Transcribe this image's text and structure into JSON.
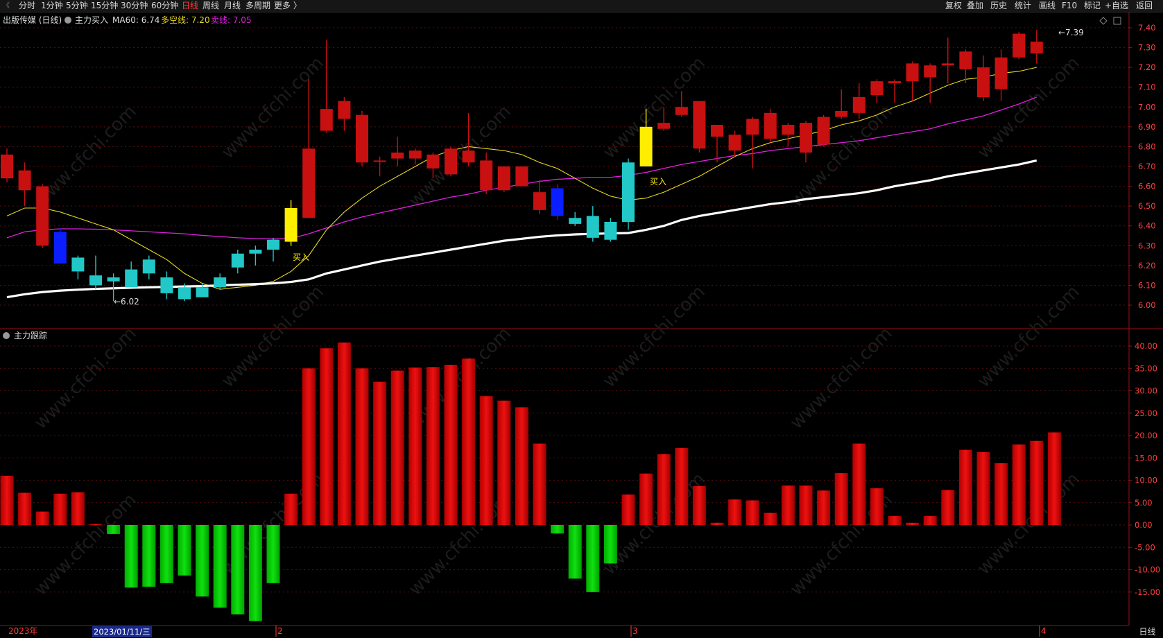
{
  "toolbar": {
    "left_items": [
      "分时",
      "1分钟",
      "5分钟",
      "15分钟",
      "30分钟",
      "60分钟",
      "日线",
      "周线",
      "月线",
      "多周期",
      "更多 〉"
    ],
    "active": "日线",
    "right_items": [
      "复权",
      "叠加",
      "历史",
      "统计",
      "画线",
      "F10",
      "标记",
      "+自选",
      "返回"
    ]
  },
  "main_panel": {
    "title": "出版传媒 (日线)",
    "indicator": "主力买入",
    "ma60_label": "MA60: 6.74",
    "duokong_label": "多空线: 7.20",
    "maixian_label": "卖线: 7.05",
    "buy_marker": "买入",
    "low_marker": "←6.02",
    "high_marker": "←7.39",
    "price_ticks": [
      "7.40",
      "7.30",
      "7.20",
      "7.10",
      "7.00",
      "6.90",
      "6.80",
      "6.70",
      "6.60",
      "6.50",
      "6.40",
      "6.30",
      "6.20",
      "6.10",
      "6.00"
    ]
  },
  "sub_panel": {
    "title": "主力跟踪",
    "ticks": [
      "40.00",
      "35.00",
      "30.00",
      "25.00",
      "20.00",
      "15.00",
      "10.00",
      "5.00",
      "0.00",
      "-5.00",
      "-10.00",
      "-15.00"
    ]
  },
  "date_axis": {
    "labels": [
      "2023年",
      "2",
      "3",
      "4"
    ],
    "cursor_date": "2023/01/11/三"
  },
  "bottom_tab": "日线",
  "watermark": "www.cfchi.com",
  "colors": {
    "up": "#c81010",
    "down": "#22c8c8",
    "yellow": "#ffee00",
    "blue": "#0a1eff",
    "ma60": "#ffffff",
    "duokong": "#e8d820",
    "maixian": "#e020e0",
    "bar_pos": "#ee1111",
    "bar_neg": "#10e010",
    "axis": "#9a1010"
  },
  "chart_data": {
    "type": "candlestick",
    "ylim": [
      5.95,
      7.45
    ],
    "sub_ylim": [
      -21,
      43
    ],
    "candles": [
      {
        "o": 6.64,
        "h": 6.79,
        "l": 6.62,
        "c": 6.76,
        "k": "up"
      },
      {
        "o": 6.58,
        "h": 6.72,
        "l": 6.5,
        "c": 6.68,
        "k": "up"
      },
      {
        "o": 6.3,
        "h": 6.61,
        "l": 6.29,
        "c": 6.6,
        "k": "up"
      },
      {
        "o": 6.37,
        "h": 6.39,
        "l": 6.21,
        "c": 6.21,
        "k": "blue"
      },
      {
        "o": 6.24,
        "h": 6.25,
        "l": 6.13,
        "c": 6.17,
        "k": "down"
      },
      {
        "o": 6.15,
        "h": 6.25,
        "l": 6.08,
        "c": 6.1,
        "k": "down"
      },
      {
        "o": 6.14,
        "h": 6.16,
        "l": 6.02,
        "c": 6.12,
        "k": "down"
      },
      {
        "o": 6.18,
        "h": 6.22,
        "l": 6.09,
        "c": 6.09,
        "k": "down"
      },
      {
        "o": 6.23,
        "h": 6.25,
        "l": 6.13,
        "c": 6.16,
        "k": "down"
      },
      {
        "o": 6.14,
        "h": 6.17,
        "l": 6.03,
        "c": 6.06,
        "k": "down"
      },
      {
        "o": 6.09,
        "h": 6.11,
        "l": 6.02,
        "c": 6.03,
        "k": "down"
      },
      {
        "o": 6.09,
        "h": 6.11,
        "l": 6.04,
        "c": 6.04,
        "k": "down"
      },
      {
        "o": 6.14,
        "h": 6.16,
        "l": 6.08,
        "c": 6.09,
        "k": "down"
      },
      {
        "o": 6.26,
        "h": 6.28,
        "l": 6.16,
        "c": 6.19,
        "k": "down"
      },
      {
        "o": 6.28,
        "h": 6.3,
        "l": 6.2,
        "c": 6.26,
        "k": "down"
      },
      {
        "o": 6.33,
        "h": 6.34,
        "l": 6.22,
        "c": 6.28,
        "k": "down"
      },
      {
        "o": 6.32,
        "h": 6.53,
        "l": 6.3,
        "c": 6.49,
        "k": "yellow"
      },
      {
        "o": 6.44,
        "h": 7.14,
        "l": 6.44,
        "c": 6.79,
        "k": "up"
      },
      {
        "o": 6.88,
        "h": 7.34,
        "l": 6.87,
        "c": 6.99,
        "k": "up"
      },
      {
        "o": 6.94,
        "h": 7.05,
        "l": 6.88,
        "c": 7.03,
        "k": "up"
      },
      {
        "o": 6.72,
        "h": 6.98,
        "l": 6.7,
        "c": 6.96,
        "k": "up"
      },
      {
        "o": 6.73,
        "h": 6.75,
        "l": 6.65,
        "c": 6.73,
        "k": "up"
      },
      {
        "o": 6.74,
        "h": 6.85,
        "l": 6.7,
        "c": 6.77,
        "k": "up"
      },
      {
        "o": 6.74,
        "h": 6.79,
        "l": 6.71,
        "c": 6.78,
        "k": "up"
      },
      {
        "o": 6.69,
        "h": 6.77,
        "l": 6.64,
        "c": 6.76,
        "k": "up"
      },
      {
        "o": 6.66,
        "h": 6.8,
        "l": 6.65,
        "c": 6.79,
        "k": "up"
      },
      {
        "o": 6.72,
        "h": 6.97,
        "l": 6.7,
        "c": 6.78,
        "k": "up"
      },
      {
        "o": 6.58,
        "h": 6.77,
        "l": 6.56,
        "c": 6.73,
        "k": "up"
      },
      {
        "o": 6.58,
        "h": 6.7,
        "l": 6.57,
        "c": 6.7,
        "k": "up"
      },
      {
        "o": 6.6,
        "h": 6.7,
        "l": 6.6,
        "c": 6.7,
        "k": "up"
      },
      {
        "o": 6.48,
        "h": 6.63,
        "l": 6.46,
        "c": 6.57,
        "k": "up"
      },
      {
        "o": 6.59,
        "h": 6.61,
        "l": 6.43,
        "c": 6.45,
        "k": "blue"
      },
      {
        "o": 6.44,
        "h": 6.47,
        "l": 6.4,
        "c": 6.41,
        "k": "down"
      },
      {
        "o": 6.45,
        "h": 6.5,
        "l": 6.32,
        "c": 6.34,
        "k": "down"
      },
      {
        "o": 6.42,
        "h": 6.44,
        "l": 6.32,
        "c": 6.33,
        "k": "down"
      },
      {
        "o": 6.72,
        "h": 6.74,
        "l": 6.38,
        "c": 6.42,
        "k": "down"
      },
      {
        "o": 6.7,
        "h": 6.99,
        "l": 6.7,
        "c": 6.9,
        "k": "yellow"
      },
      {
        "o": 6.89,
        "h": 7.0,
        "l": 6.88,
        "c": 6.92,
        "k": "up"
      },
      {
        "o": 6.96,
        "h": 7.08,
        "l": 6.95,
        "c": 7.0,
        "k": "up"
      },
      {
        "o": 6.79,
        "h": 7.03,
        "l": 6.77,
        "c": 7.03,
        "k": "up"
      },
      {
        "o": 6.85,
        "h": 6.91,
        "l": 6.72,
        "c": 6.91,
        "k": "up"
      },
      {
        "o": 6.78,
        "h": 6.88,
        "l": 6.75,
        "c": 6.86,
        "k": "up"
      },
      {
        "o": 6.86,
        "h": 6.95,
        "l": 6.69,
        "c": 6.94,
        "k": "up"
      },
      {
        "o": 6.84,
        "h": 6.99,
        "l": 6.82,
        "c": 6.97,
        "k": "up"
      },
      {
        "o": 6.86,
        "h": 6.92,
        "l": 6.8,
        "c": 6.91,
        "k": "up"
      },
      {
        "o": 6.77,
        "h": 6.93,
        "l": 6.72,
        "c": 6.92,
        "k": "up"
      },
      {
        "o": 6.81,
        "h": 6.96,
        "l": 6.8,
        "c": 6.95,
        "k": "up"
      },
      {
        "o": 6.95,
        "h": 7.09,
        "l": 6.94,
        "c": 6.98,
        "k": "up"
      },
      {
        "o": 6.97,
        "h": 7.12,
        "l": 6.94,
        "c": 7.05,
        "k": "up"
      },
      {
        "o": 7.06,
        "h": 7.14,
        "l": 7.02,
        "c": 7.13,
        "k": "up"
      },
      {
        "o": 7.12,
        "h": 7.14,
        "l": 7.02,
        "c": 7.13,
        "k": "up"
      },
      {
        "o": 7.13,
        "h": 7.23,
        "l": 7.03,
        "c": 7.22,
        "k": "up"
      },
      {
        "o": 7.15,
        "h": 7.22,
        "l": 7.02,
        "c": 7.21,
        "k": "up"
      },
      {
        "o": 7.21,
        "h": 7.35,
        "l": 7.12,
        "c": 7.22,
        "k": "up"
      },
      {
        "o": 7.19,
        "h": 7.29,
        "l": 7.12,
        "c": 7.28,
        "k": "up"
      },
      {
        "o": 7.05,
        "h": 7.26,
        "l": 7.03,
        "c": 7.2,
        "k": "up"
      },
      {
        "o": 7.09,
        "h": 7.29,
        "l": 7.03,
        "c": 7.25,
        "k": "up"
      },
      {
        "o": 7.25,
        "h": 7.38,
        "l": 7.24,
        "c": 7.37,
        "k": "up"
      },
      {
        "o": 7.27,
        "h": 7.39,
        "l": 7.22,
        "c": 7.33,
        "k": "up"
      }
    ],
    "ma60": [
      6.04,
      6.055,
      6.066,
      6.073,
      6.078,
      6.082,
      6.085,
      6.088,
      6.09,
      6.092,
      6.094,
      6.096,
      6.1,
      6.103,
      6.106,
      6.11,
      6.117,
      6.13,
      6.16,
      6.18,
      6.2,
      6.22,
      6.235,
      6.25,
      6.265,
      6.28,
      6.295,
      6.31,
      6.325,
      6.335,
      6.345,
      6.352,
      6.357,
      6.36,
      6.362,
      6.364,
      6.38,
      6.4,
      6.43,
      6.45,
      6.465,
      6.48,
      6.495,
      6.51,
      6.52,
      6.535,
      6.545,
      6.555,
      6.565,
      6.58,
      6.6,
      6.615,
      6.63,
      6.65,
      6.665,
      6.68,
      6.695,
      6.71,
      6.73
    ],
    "duokong": [
      6.45,
      6.49,
      6.49,
      6.47,
      6.44,
      6.41,
      6.38,
      6.33,
      6.28,
      6.23,
      6.16,
      6.11,
      6.08,
      6.09,
      6.1,
      6.12,
      6.17,
      6.25,
      6.38,
      6.47,
      6.54,
      6.6,
      6.65,
      6.7,
      6.75,
      6.78,
      6.8,
      6.79,
      6.78,
      6.76,
      6.72,
      6.69,
      6.64,
      6.59,
      6.55,
      6.53,
      6.54,
      6.57,
      6.61,
      6.65,
      6.7,
      6.75,
      6.79,
      6.82,
      6.84,
      6.86,
      6.88,
      6.91,
      6.93,
      6.96,
      7.0,
      7.03,
      7.07,
      7.11,
      7.14,
      7.15,
      7.17,
      7.18,
      7.2
    ],
    "maixian": [
      6.34,
      6.37,
      6.38,
      6.385,
      6.385,
      6.383,
      6.38,
      6.375,
      6.37,
      6.365,
      6.36,
      6.352,
      6.346,
      6.34,
      6.336,
      6.334,
      6.336,
      6.36,
      6.39,
      6.42,
      6.445,
      6.465,
      6.485,
      6.505,
      6.525,
      6.545,
      6.56,
      6.58,
      6.595,
      6.61,
      6.625,
      6.635,
      6.64,
      6.645,
      6.645,
      6.655,
      6.67,
      6.69,
      6.71,
      6.725,
      6.74,
      6.755,
      6.765,
      6.78,
      6.79,
      6.8,
      6.81,
      6.82,
      6.83,
      6.845,
      6.86,
      6.875,
      6.89,
      6.915,
      6.935,
      6.955,
      6.985,
      7.015,
      7.05
    ],
    "zhuli": [
      11,
      7.2,
      3,
      7,
      7.3,
      0.2,
      -2,
      -14,
      -13.8,
      -13,
      -11.3,
      -16,
      -18.5,
      -20,
      -21.5,
      -13,
      7,
      35,
      39.5,
      40.8,
      35,
      32,
      34.5,
      35.2,
      35.3,
      35.8,
      37.2,
      28.8,
      27.8,
      26.3,
      18.2,
      -1.9,
      -12,
      -15,
      -8.6,
      6.8,
      11.5,
      15.8,
      17.2,
      8.7,
      0.5,
      5.7,
      5.5,
      2.7,
      8.8,
      8.8,
      7.7,
      11.6,
      18.2,
      8.2,
      2,
      0.5,
      2,
      7.8,
      16.8,
      16.3,
      13.8,
      18,
      18.8,
      20.7
    ]
  }
}
